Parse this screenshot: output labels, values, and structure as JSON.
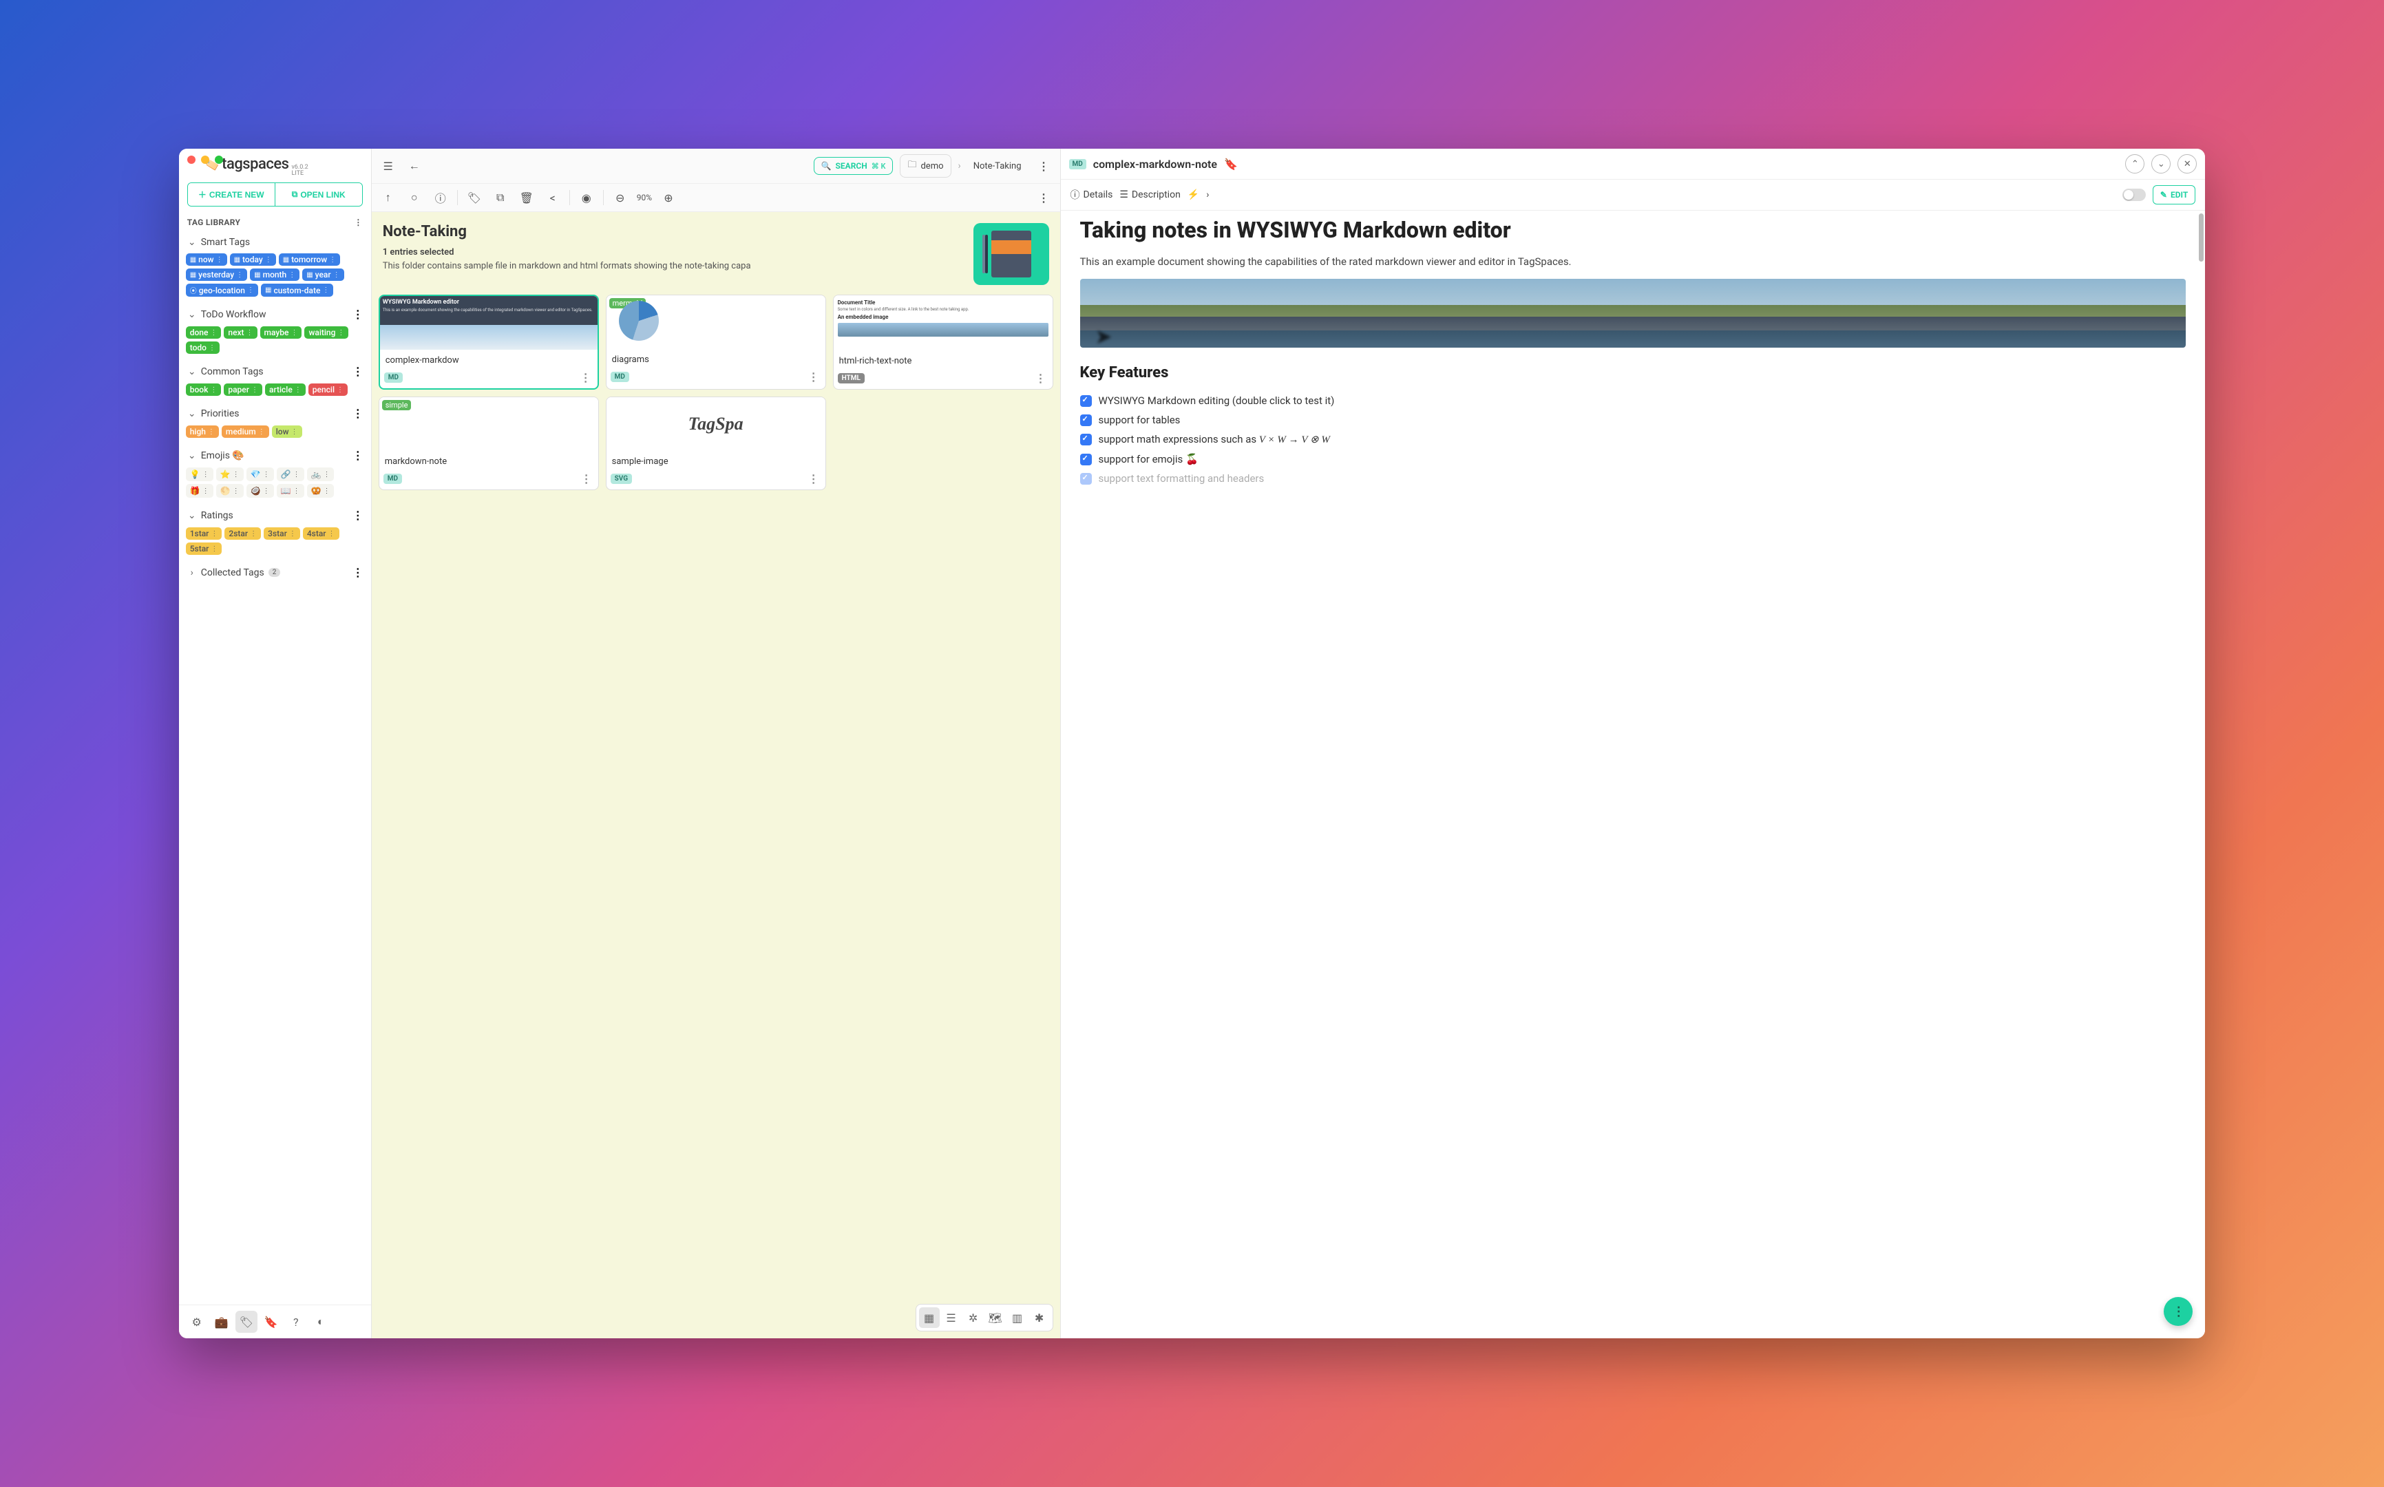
{
  "app": {
    "name": "tagspaces",
    "version": "v6.0.2",
    "edition": "LITE"
  },
  "topButtons": {
    "create": "CREATE NEW",
    "open": "OPEN LINK"
  },
  "tagLibrary": {
    "title": "TAG LIBRARY",
    "sections": {
      "smart": {
        "label": "Smart Tags",
        "tags": [
          "now",
          "today",
          "tomorrow",
          "yesterday",
          "month",
          "year",
          "geo-location",
          "custom-date"
        ]
      },
      "todo": {
        "label": "ToDo Workflow",
        "tags": [
          "done",
          "next",
          "maybe",
          "waiting",
          "todo"
        ]
      },
      "common": {
        "label": "Common Tags",
        "tags": [
          "book",
          "paper",
          "article",
          "pencil"
        ]
      },
      "priorities": {
        "label": "Priorities",
        "tags": [
          "high",
          "medium",
          "low"
        ]
      },
      "emojis": {
        "label": "Emojis 🎨",
        "items": [
          "💡",
          "⭐",
          "💎",
          "🔗",
          "🚲",
          "🎁",
          "🌕",
          "🥥",
          "📖",
          "🥨"
        ]
      },
      "ratings": {
        "label": "Ratings",
        "tags": [
          "1star",
          "2star",
          "3star",
          "4star",
          "5star"
        ]
      },
      "collected": {
        "label": "Collected Tags",
        "count": "2"
      }
    }
  },
  "search": {
    "label": "SEARCH",
    "kbd": "⌘ K"
  },
  "breadcrumb": {
    "root": "demo",
    "current": "Note-Taking"
  },
  "zoom": "90%",
  "folder": {
    "title": "Note-Taking",
    "selected": "1 entries selected",
    "desc": "This folder contains sample file in markdown and html formats showing the note-taking capa"
  },
  "cards": {
    "c1": {
      "name": "complex-markdow",
      "type": "MD",
      "thumbTitle": "WYSIWYG Markdown editor",
      "thumbBody": "This is an example document showing the capabilities of the integrated markdown viewer and editor in TagSpaces."
    },
    "c2": {
      "name": "diagrams",
      "type": "MD",
      "chip": "mermaid"
    },
    "c3": {
      "name": "html-rich-text-note",
      "type": "HTML",
      "thumbTitle": "Document Title",
      "thumbLine": "Some text in colors and different size. A link to the best note taking app.",
      "thumbSub": "An embedded image"
    },
    "c4": {
      "name": "markdown-note",
      "type": "MD",
      "chip": "simple"
    },
    "c5": {
      "name": "sample-image",
      "type": "SVG",
      "logo": "TagSpa"
    }
  },
  "rightPanel": {
    "fileType": "MD",
    "fileName": "complex-markdown-note",
    "details": "Details",
    "description": "Description",
    "edit": "EDIT"
  },
  "document": {
    "h1": "Taking notes in WYSIWYG Markdown editor",
    "p1": "This      an example document showing the capabilities of the        rated markdown viewer and editor in TagSpaces.",
    "h2": "Key Features",
    "items": [
      "WYSIWYG Markdown editing (double click to test it)",
      "support for tables",
      "support math expressions such as",
      "support for emojis 🍒",
      "support text formatting and headers"
    ],
    "math": "V × W → V ⊗ W"
  }
}
